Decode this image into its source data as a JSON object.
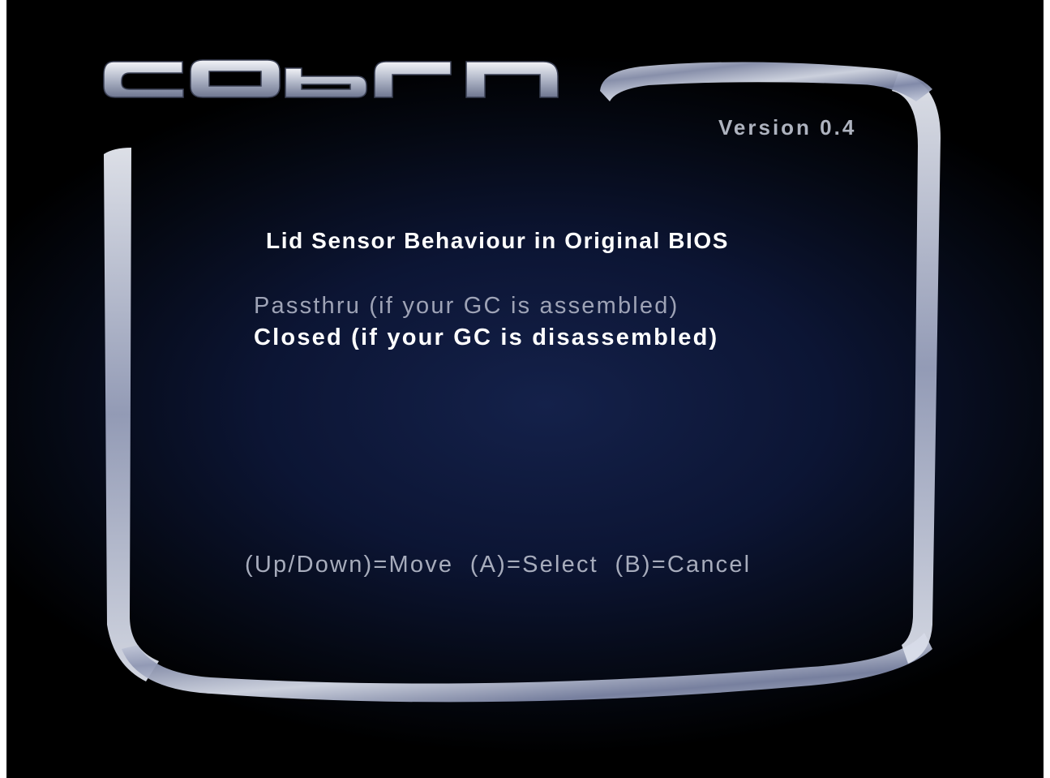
{
  "header": {
    "logo_text": "cobra",
    "version": "Version 0.4"
  },
  "menu": {
    "title": "Lid Sensor Behaviour in Original BIOS",
    "options": [
      {
        "label": "Passthru (if your GC is assembled)",
        "selected": false
      },
      {
        "label": "Closed (if your GC is disassembled)",
        "selected": true
      }
    ]
  },
  "footer": {
    "controls": "(Up/Down)=Move  (A)=Select  (B)=Cancel"
  },
  "colors": {
    "background": "#0c1534",
    "frame": "#b9bfd4",
    "selected_text": "#ffffff",
    "unselected_text": "#9ea3b6"
  }
}
